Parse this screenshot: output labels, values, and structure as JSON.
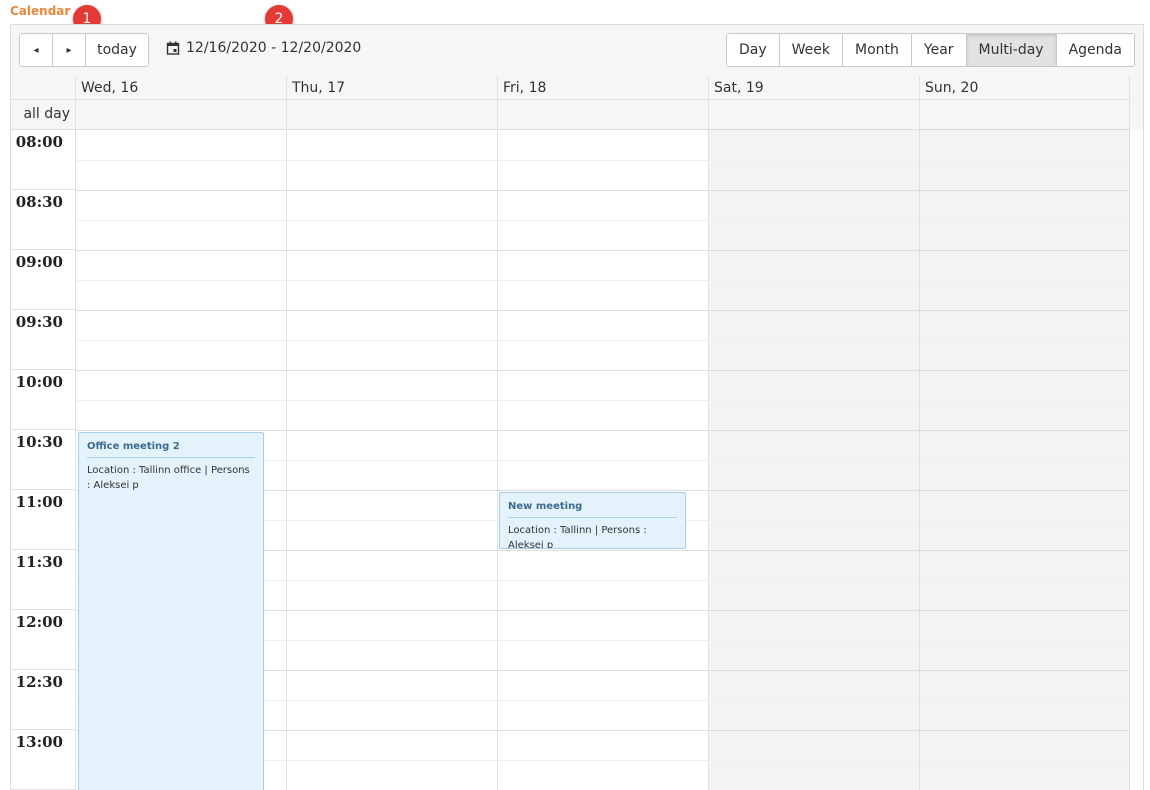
{
  "section_title": "Calendar",
  "markers": [
    "1",
    "2"
  ],
  "toolbar": {
    "prev_icon": "◂",
    "next_icon": "▸",
    "today_label": "today",
    "date_range": "12/16/2020 - 12/20/2020",
    "views": [
      "Day",
      "Week",
      "Month",
      "Year",
      "Multi-day",
      "Agenda"
    ],
    "active_view": "Multi-day"
  },
  "allday_label": "all day",
  "days": [
    "Wed, 16",
    "Thu, 17",
    "Fri, 18",
    "Sat, 19",
    "Sun, 20"
  ],
  "times": [
    "08:00",
    "08:30",
    "09:00",
    "09:30",
    "10:00",
    "10:30",
    "11:00",
    "11:30",
    "12:00",
    "12:30",
    "13:00"
  ],
  "events": [
    {
      "title": "Office meeting 2",
      "description": "Location : Tallinn office | Persons : Aleksei p",
      "day": "Wed, 16",
      "start": "10:30"
    },
    {
      "title": "New meeting",
      "description": "Location : Tallinn | Persons : Aleksei p",
      "day": "Fri, 18",
      "start": "11:00"
    }
  ],
  "colors": {
    "accent": "#e8883a",
    "marker": "#e53935",
    "event_bg": "#e3f2fb",
    "event_border": "#a9cde4",
    "event_title": "#3d6a8f",
    "weekend_bg": "#f3f3f3"
  }
}
